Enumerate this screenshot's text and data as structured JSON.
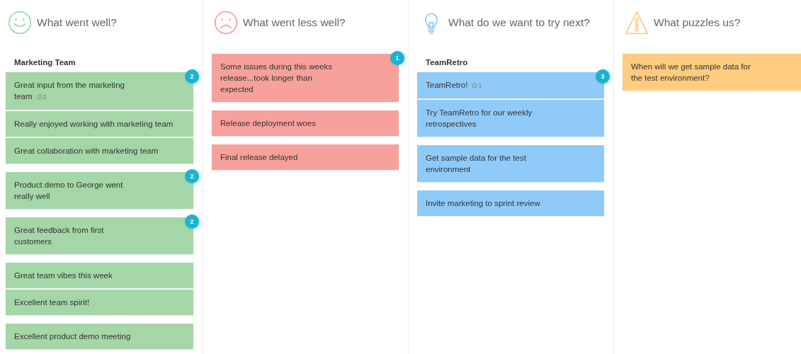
{
  "columns": [
    {
      "title": "What went well?",
      "kind": "smile",
      "color": "#a5d6a7",
      "stacks": [
        {
          "label": "Marketing Team",
          "cards": [
            {
              "text": "Great input from the marketing\nteam",
              "votes": "2",
              "badge": "2"
            },
            {
              "text": "Really enjoyed working with marketing team"
            },
            {
              "text": "Great collaboration with marketing team"
            }
          ]
        },
        {
          "cards": [
            {
              "text": "Product demo to George went\nreally well",
              "badge": "2"
            }
          ]
        },
        {
          "cards": [
            {
              "text": "Great feedback from first\ncustomers",
              "badge": "2"
            }
          ]
        },
        {
          "cards": [
            {
              "text": "Great team vibes this week"
            },
            {
              "text": "Excellent team spirit!"
            }
          ]
        },
        {
          "cards": [
            {
              "text": "Excellent product demo meeting"
            }
          ]
        }
      ]
    },
    {
      "title": "What went less well?",
      "kind": "frown",
      "color": "#f6a19c",
      "stacks": [
        {
          "cards": [
            {
              "text": "Some issues during this weeks\nrelease...took longer than\nexpected",
              "badge": "1"
            }
          ]
        },
        {
          "cards": [
            {
              "text": "Release deployment woes"
            }
          ]
        },
        {
          "cards": [
            {
              "text": "Final release delayed"
            }
          ]
        }
      ]
    },
    {
      "title": "What do we want to try next?",
      "kind": "bulb",
      "color": "#90caf9",
      "stacks": [
        {
          "label": "TeamRetro",
          "cards": [
            {
              "text": "TeamRetro!",
              "votes": "1",
              "badge": "3"
            },
            {
              "text": "Try TeamRetro for our weekly\nretrospectives"
            }
          ]
        },
        {
          "cards": [
            {
              "text": "Get sample data for the test\nenvironment"
            }
          ]
        },
        {
          "cards": [
            {
              "text": "Invite marketing to sprint review"
            }
          ]
        }
      ]
    },
    {
      "title": "What puzzles us?",
      "kind": "warning",
      "color": "#ffcc80",
      "stacks": [
        {
          "cards": [
            {
              "text": "When will we get sample data for\nthe test environment?"
            }
          ]
        }
      ]
    }
  ]
}
